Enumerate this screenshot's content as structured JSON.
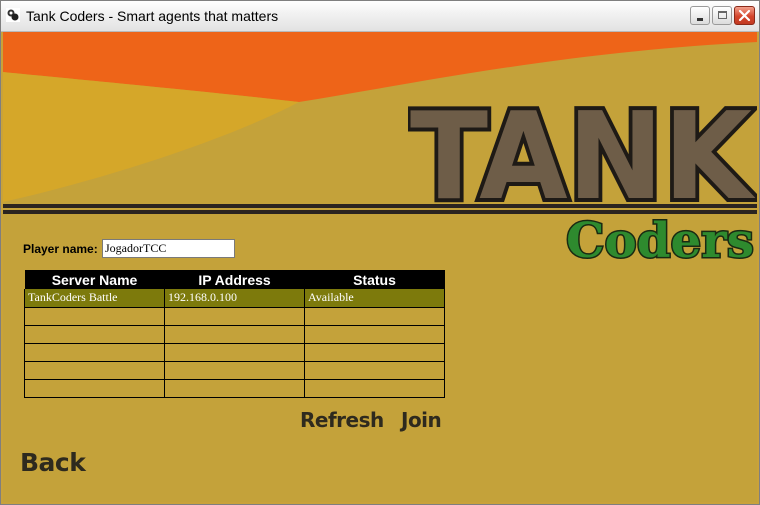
{
  "window": {
    "title": "Tank Coders - Smart agents that matters"
  },
  "logo": {
    "line1": "TANK",
    "line2": "Coders"
  },
  "form": {
    "player_label": "Player name:",
    "player_value": "JogadorTCC"
  },
  "table": {
    "headers": [
      "Server Name",
      "IP Address",
      "Status"
    ],
    "rows": [
      [
        "TankCoders Battle",
        "192.168.0.100",
        "Available"
      ],
      [
        "",
        "",
        ""
      ],
      [
        "",
        "",
        ""
      ],
      [
        "",
        "",
        ""
      ],
      [
        "",
        "",
        ""
      ],
      [
        "",
        "",
        ""
      ]
    ]
  },
  "buttons": {
    "refresh": "Refresh",
    "join": "Join",
    "back": "Back"
  },
  "colors": {
    "background": "#c4a23a",
    "orange_band": "#ee6418",
    "logo_fill": "#6e5d48",
    "selected_row": "#7d7a0c",
    "coders_green": "#2e8a2e"
  },
  "icons": {
    "app": "tank-app-icon",
    "minimize": "minimize-icon",
    "maximize": "maximize-icon",
    "close": "close-icon"
  }
}
